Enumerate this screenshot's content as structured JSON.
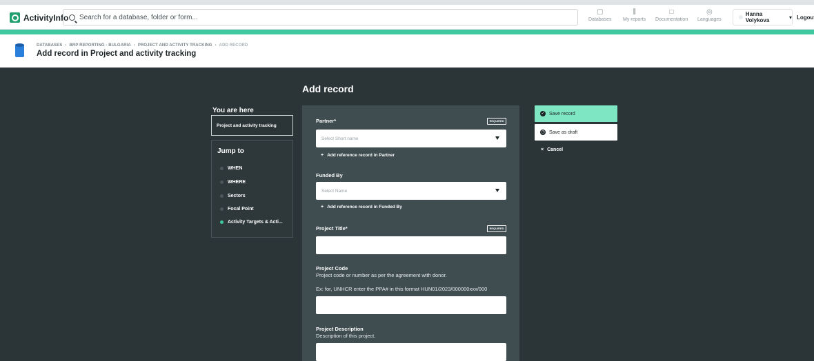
{
  "app": {
    "name": "ActivityInfo"
  },
  "search": {
    "placeholder": "Search for a database, folder or form..."
  },
  "nav": {
    "databases": "Databases",
    "my_reports": "My reports",
    "documentation": "Documentation",
    "languages": "Languages"
  },
  "user": {
    "name": "Hanna Volykova",
    "logout": "Logout"
  },
  "breadcrumb": [
    "DATABASES",
    "BRP REPORTING - BULGARIA",
    "PROJECT AND ACTIVITY TRACKING",
    "ADD RECORD"
  ],
  "page_title": "Add record in Project and activity tracking",
  "form_heading": "Add record",
  "sidebar": {
    "here_label": "You are here",
    "here_value": "Project and activity tracking",
    "jump_title": "Jump to",
    "items": [
      "WHEN",
      "WHERE",
      "Sectors",
      "Focal Point",
      "Activity Targets & Acti..."
    ]
  },
  "form": {
    "partner": {
      "label": "Partner*",
      "required": "REQUIRED",
      "placeholder": "Select Short name",
      "add_ref": "Add reference record in Partner"
    },
    "funded_by": {
      "label": "Funded By",
      "placeholder": "Select Name",
      "add_ref": "Add reference record in Funded By"
    },
    "project_title": {
      "label": "Project Title*",
      "required": "REQUIRED",
      "value": ""
    },
    "project_code": {
      "label": "Project Code",
      "desc1": "Project code or number as per the agreement with donor.",
      "desc2": "Ex: for, UNHCR enter the PPA# in this format HUN01/2023/000000xxx/000",
      "value": ""
    },
    "project_description": {
      "label": "Project Description",
      "desc": "Description of this project.",
      "value": ""
    }
  },
  "actions": {
    "save": "Save record",
    "draft": "Save as draft",
    "cancel": "Cancel"
  },
  "colors": {
    "accent": "#3ec8a0",
    "save_button": "#7fe6c3",
    "background": "#2b3437",
    "form_panel": "#3f4d51"
  }
}
